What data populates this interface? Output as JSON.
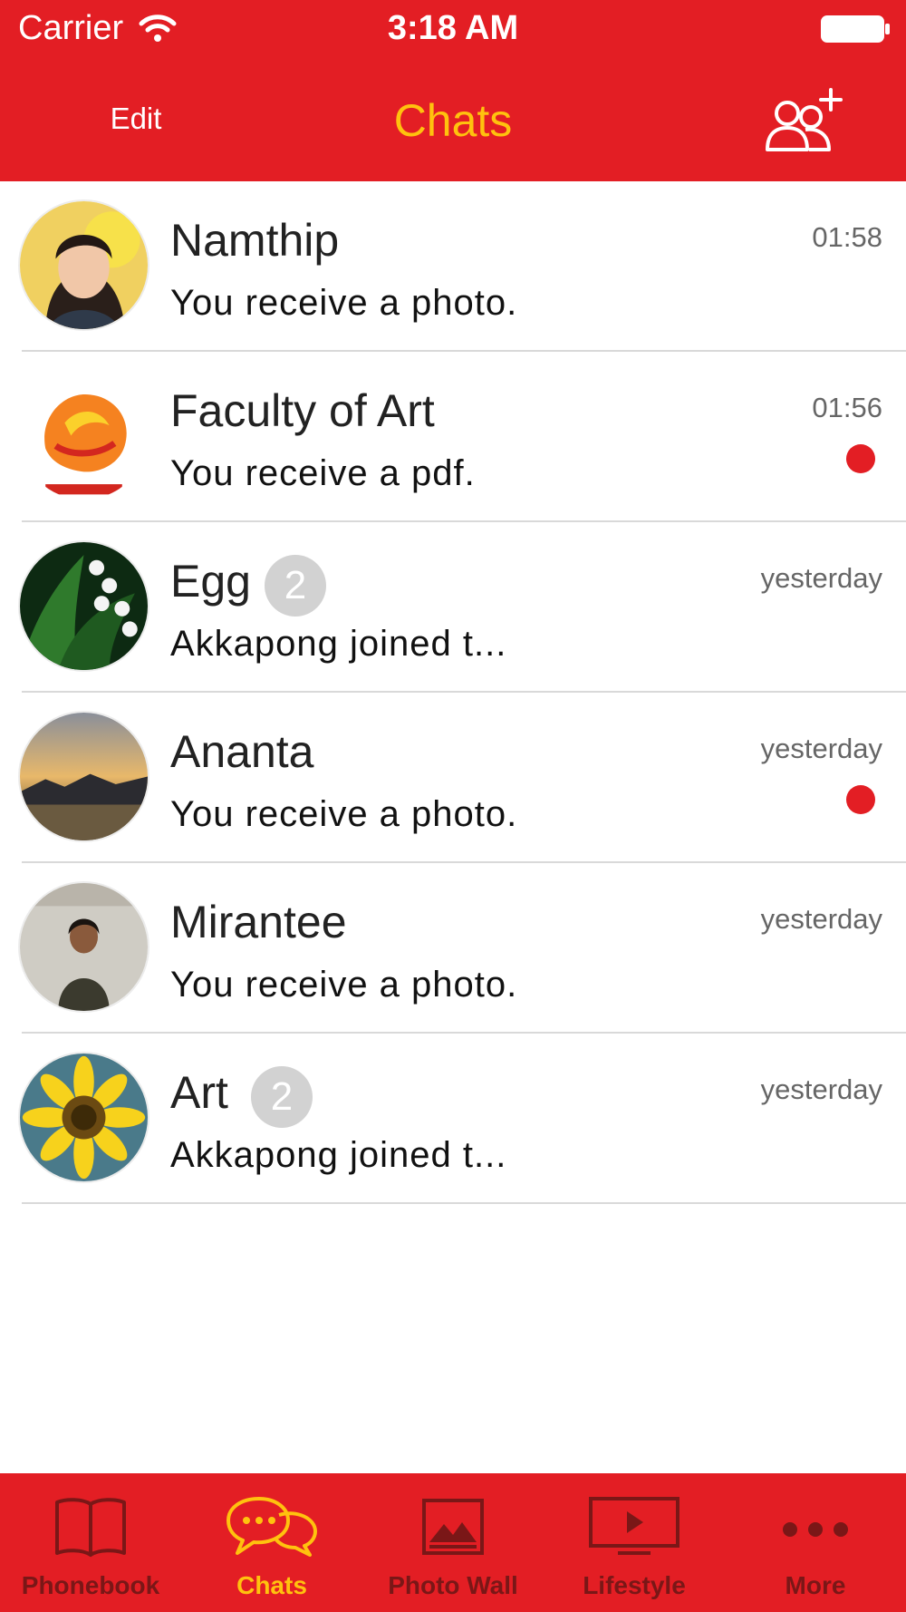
{
  "status_bar": {
    "carrier": "Carrier",
    "time": "3:18 AM"
  },
  "nav": {
    "edit_label": "Edit",
    "title": "Chats",
    "add_icon": "add-contact-icon"
  },
  "colors": {
    "brand_red": "#e31e24",
    "accent_yellow": "#ffc20e",
    "badge_gray": "#d2d2d2",
    "tab_inactive": "#7a1717"
  },
  "chats": [
    {
      "name": "Namthip",
      "preview": "You receive a photo.",
      "time": "01:58",
      "badge": "",
      "unread_dot": false
    },
    {
      "name": "Faculty of Art",
      "preview": "You receive a pdf.",
      "time": "01:56",
      "badge": "",
      "unread_dot": true
    },
    {
      "name": "Egg",
      "preview": "Akkapong joined t...",
      "time": "yesterday",
      "badge": "2",
      "unread_dot": false
    },
    {
      "name": "Ananta",
      "preview": "You receive a photo.",
      "time": "yesterday",
      "badge": "",
      "unread_dot": true
    },
    {
      "name": "Mirantee",
      "preview": "You receive a photo.",
      "time": "yesterday",
      "badge": "",
      "unread_dot": false
    },
    {
      "name": "Art",
      "preview": "Akkapong joined t...",
      "time": "yesterday",
      "badge": "2",
      "unread_dot": false
    }
  ],
  "tabs": [
    {
      "label": "Phonebook",
      "icon": "book-icon",
      "active": false
    },
    {
      "label": "Chats",
      "icon": "chat-bubbles-icon",
      "active": true
    },
    {
      "label": "Photo Wall",
      "icon": "photo-icon",
      "active": false
    },
    {
      "label": "Lifestyle",
      "icon": "video-icon",
      "active": false
    },
    {
      "label": "More",
      "icon": "more-dots-icon",
      "active": false
    }
  ]
}
